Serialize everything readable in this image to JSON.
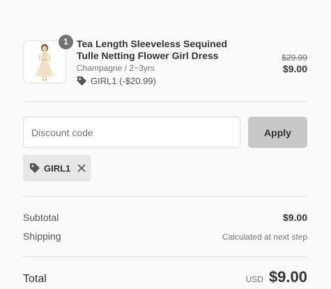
{
  "product": {
    "quantity": "1",
    "title": "Tea Length Sleeveless Sequined Tulle Netting Flower Girl Dress",
    "variant": "Champagne / 2~3yrs",
    "discount_text": "GIRL1 (-$20.99)",
    "compare_price": "$29.99",
    "price": "$9.00",
    "image_icon": "dress-thumbnail",
    "discount_icon": "tag-icon"
  },
  "discount": {
    "placeholder": "Discount code",
    "apply_label": "Apply",
    "applied_code": "GIRL1",
    "applied_icon": "tag-icon",
    "remove_icon": "close-icon"
  },
  "summary": {
    "subtotal_label": "Subtotal",
    "subtotal_value": "$9.00",
    "shipping_label": "Shipping",
    "shipping_value": "Calculated at next step",
    "total_label": "Total",
    "currency": "USD",
    "total_value": "$9.00"
  },
  "colors": {
    "background": "#fafafa",
    "badge": "#737373",
    "apply_button": "#c8c8c8",
    "chip": "#e7e7e7",
    "text_primary": "#333333",
    "text_secondary": "#737373"
  }
}
